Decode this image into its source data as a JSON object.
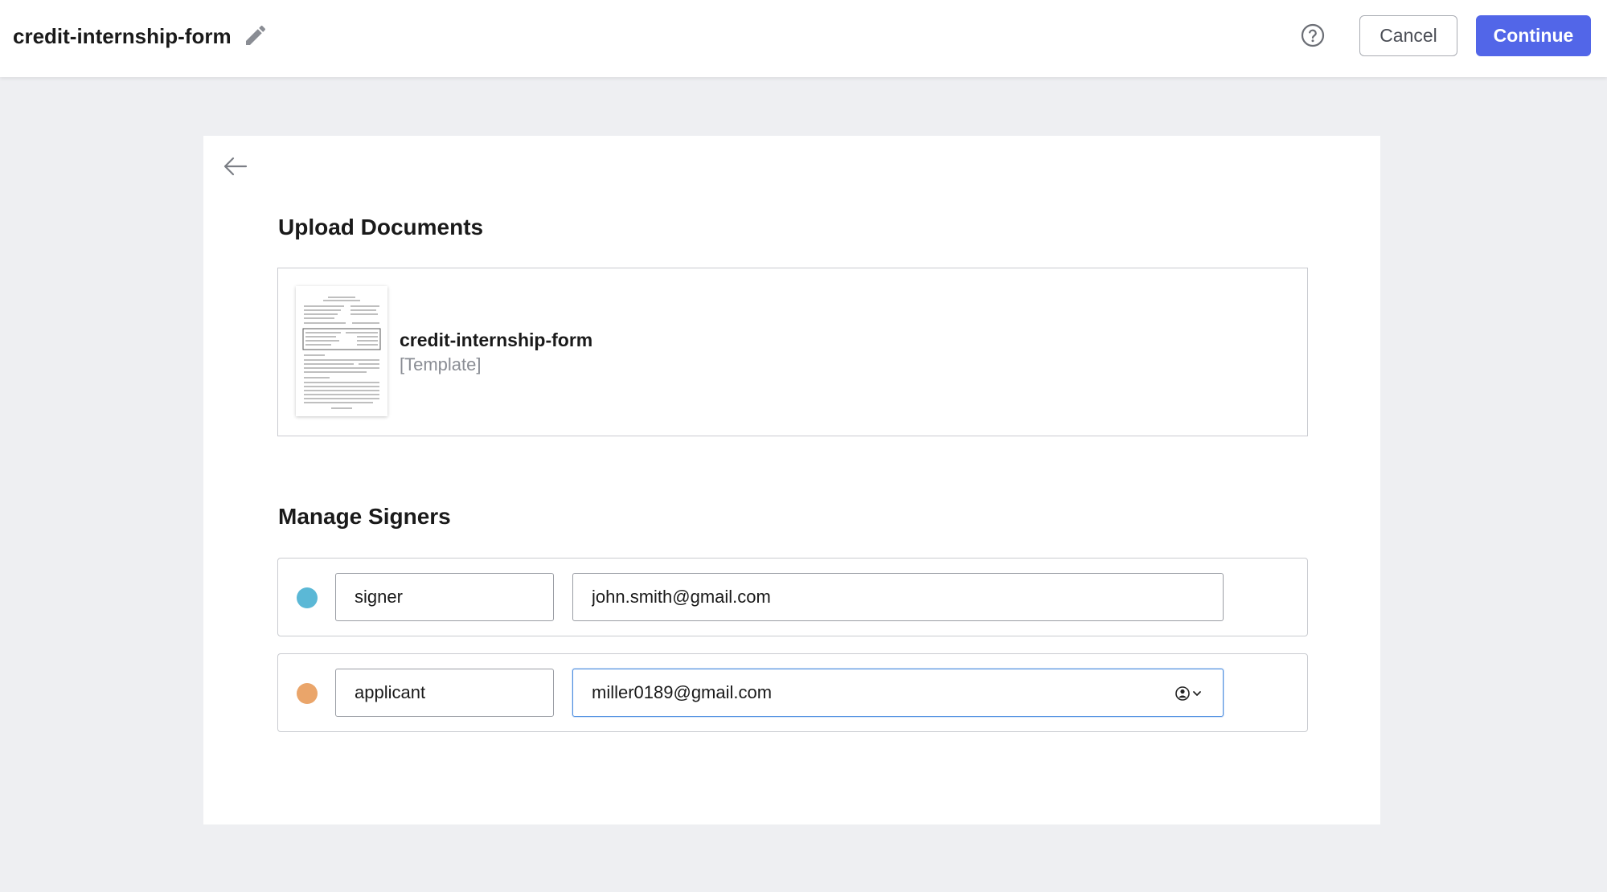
{
  "header": {
    "title": "credit-internship-form",
    "edit_icon": "pencil-icon",
    "help_icon": "question-circle-icon",
    "cancel_label": "Cancel",
    "continue_label": "Continue",
    "accent_color": "#5266e8"
  },
  "upload": {
    "heading": "Upload Documents",
    "document": {
      "name": "credit-internship-form",
      "tag": "[Template]"
    }
  },
  "signers": {
    "heading": "Manage Signers",
    "rows": [
      {
        "role": "signer",
        "email": "john.smith@gmail.com",
        "color": "#5bb8d6"
      },
      {
        "role": "applicant",
        "email": "miller0189@gmail.com",
        "color": "#eaa56a"
      }
    ]
  }
}
